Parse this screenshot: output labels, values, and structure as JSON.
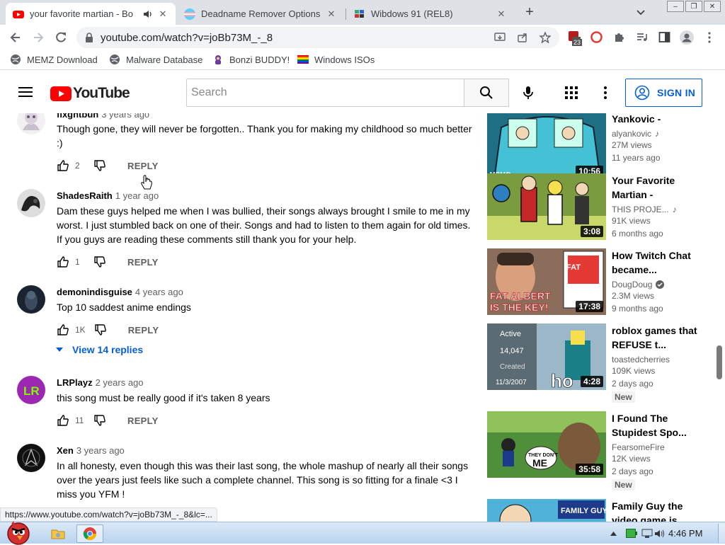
{
  "browser": {
    "tabs": [
      {
        "title": "your favorite martian - Bo",
        "active": true
      },
      {
        "title": "Deadname Remover Options",
        "active": false
      },
      {
        "title": "Wibdows 91 (REL8)",
        "active": false
      }
    ],
    "url": "youtube.com/watch?v=joBb73M_-_8",
    "ext_badge": "23",
    "bookmarks": [
      "MEMZ Download",
      "Malware Database",
      "Bonzi BUDDY!",
      "Windows ISOs"
    ],
    "status_url": "https://www.youtube.com/watch?v=joBb73M_-_8&lc=..."
  },
  "youtube": {
    "logo": "YouTube",
    "search_placeholder": "Search",
    "signin_label": "SIGN IN",
    "reply_label": "REPLY",
    "view_replies": "View 14 replies"
  },
  "comments": [
    {
      "author": "fixghtbun",
      "time": "3 years ago",
      "text": "Though gone, they will never be forgotten.. Thank you for making my childhood so much better :)",
      "likes": "2"
    },
    {
      "author": "ShadesRaith",
      "time": "1 year ago",
      "text": "Dam these guys helped me when I was bullied, their songs always brought I smile to me in my worst. I just stumbled back on one of their. Songs and had to listen to them again for old times. If you guys are reading these comments still thank you for your help.",
      "likes": "1"
    },
    {
      "author": "demonindisguise",
      "time": "4 years ago",
      "text": "Top 10 saddest anime endings",
      "likes": "1K"
    },
    {
      "author": "LRPlayz",
      "time": "2 years ago",
      "text": "this song must be really good if it's taken 8 years",
      "likes": "11"
    },
    {
      "author": "Xen",
      "time": "3 years ago",
      "text": "In all honesty, even though this was their last song, the whole mashup of nearly all their songs over the years just feels like such a complete channel. This song is so fitting for a finale <3 I miss you YFM !",
      "likes": ""
    }
  ],
  "recommended": [
    {
      "title": "Yankovic -",
      "channel": "alyankovic",
      "views": "27M views",
      "age": "11 years ago",
      "duration": "10:56",
      "new": ""
    },
    {
      "title": "Your Favorite Martian -",
      "channel": "THIS PROJE...",
      "views": "91K views",
      "age": "6 months ago",
      "duration": "3:08",
      "new": ""
    },
    {
      "title": "How Twitch Chat became...",
      "channel": "DougDoug",
      "views": "2.3M views",
      "age": "9 months ago",
      "duration": "17:38",
      "new": ""
    },
    {
      "title": "roblox games that REFUSE t...",
      "channel": "toastedcherries",
      "views": "109K views",
      "age": "2 days ago",
      "duration": "4:28",
      "new": "New"
    },
    {
      "title": "I Found The Stupidest Spo...",
      "channel": "FearsomeFire",
      "views": "12K views",
      "age": "2 days ago",
      "duration": "35:58",
      "new": "New"
    },
    {
      "title": "Family Guy the video game is...",
      "channel": "",
      "views": "",
      "age": "",
      "duration": "",
      "new": ""
    }
  ],
  "thumb_text": {
    "vevo": "vevo",
    "fat_albert_1": "FAT ALBERT",
    "fat_albert_2": "IS THE KEY!",
    "roblox_active": "Active",
    "roblox_count": "14,047",
    "roblox_created": "Created",
    "roblox_date": "11/3/2007",
    "roblox_ho": "ho",
    "dont_me": "THEY DON'T",
    "dont_me2": "ME",
    "family_guy": "FAMILY GUY"
  },
  "taskbar": {
    "clock": "4:46 PM"
  },
  "colors": {
    "yt_red": "#ff0000",
    "link_blue": "#065fd4",
    "text_primary": "#030303",
    "text_secondary": "#606060"
  }
}
